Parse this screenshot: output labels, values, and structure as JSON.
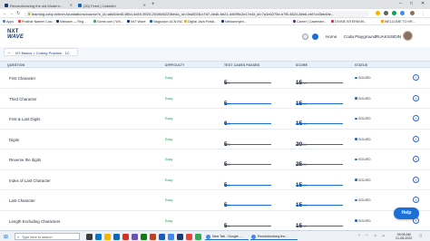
{
  "browser": {
    "tabs": [
      {
        "title": "Revolutionizing the old Modern...",
        "active": false
      },
      {
        "title": "(20) Feed | LinkedIn",
        "active": false
      },
      {
        "title": "learning.ccbp.in",
        "active": true
      }
    ],
    "url": "learning.ccbp.in/tech-foundations/course?c_id=a6d54e46-8f0d-4d49-9920-251f6b52236e&s_id=0ba3028-b7d7-4b4b-bb21-d4f0f9c2e17e&t_id=7a1b0275e-b7f6-4824-8bb6-ebf7cd3bb48e...",
    "bookmarks": [
      "Apps",
      "Prakhar Naeem Coa...",
      "Nxtwave — Reg...",
      "Gcme.com | Wh...",
      "NxT Wave",
      "Nagpurjon UCN INC",
      "Digital Java Portal...",
      "Nxtwave/gen...",
      "Career | Caselearn...",
      "DIVINE INTERNSHI...",
      "WELCOME TO HR..."
    ]
  },
  "app": {
    "logo_top": "NXT",
    "logo_bottom": "WAVE",
    "nav": {
      "home": "Home",
      "coding_playground": "Coda Playground",
      "username": "RUAKSSIDIN"
    }
  },
  "breadcrumb": "I/O Basics > Coding Practice - 1C",
  "table": {
    "headers": [
      "QUESTION",
      "DIFFICULTY",
      "TEST CASES PASSED",
      "SCORE",
      "STATUS"
    ],
    "rows": [
      {
        "question": "First Character",
        "difficulty": "Easy",
        "passed": "5",
        "total": "/5",
        "score": "15",
        "score_total": "/15",
        "progress": 1.0,
        "status": "SOLVED"
      },
      {
        "question": "Third Character",
        "difficulty": "Easy",
        "passed": "5",
        "total": "/5",
        "score": "15",
        "score_total": "/15",
        "progress": 1.0,
        "status": "SOLVED"
      },
      {
        "question": "First & Last Digits",
        "difficulty": "Easy",
        "passed": "6",
        "total": "/6",
        "score": "15",
        "score_total": "/15",
        "progress": 1.0,
        "status": "SOLVED"
      },
      {
        "question": "Digits",
        "difficulty": "Easy",
        "passed": "5",
        "total": "/5",
        "score": "20",
        "score_total": "/20",
        "progress": 1.0,
        "status": "SOLVED"
      },
      {
        "question": "Reverse the digits",
        "difficulty": "Easy",
        "passed": "5",
        "total": "/5",
        "score": "25",
        "score_total": "/25",
        "progress": 1.0,
        "status": "SOLVED"
      },
      {
        "question": "Index of Last Character",
        "difficulty": "Easy",
        "passed": "5",
        "total": "/5",
        "score": "15",
        "score_total": "/15",
        "progress": 1.0,
        "status": "SOLVED"
      },
      {
        "question": "Last Character",
        "difficulty": "Easy",
        "passed": "5",
        "total": "/5",
        "score": "15",
        "score_total": "/15",
        "progress": 1.0,
        "status": "SOLVED"
      },
      {
        "question": "Length Excluding Characters",
        "difficulty": "Easy",
        "passed": "5",
        "total": "/5",
        "score": "15",
        "score_total": "/15",
        "progress": 1.0,
        "status": "SOLVED"
      }
    ]
  },
  "help_label": "Help",
  "taskbar": {
    "search_placeholder": "Type here to search",
    "apps": [
      "New Tab - Google ...",
      "Revolutionizing the..."
    ],
    "time": "09:05 AM",
    "date": "21-08-2022"
  },
  "colors": {
    "accent": "#1d6fd8",
    "easy": "#16a34a",
    "header_bg": "#e9f0f8"
  },
  "icons": {
    "go": "arrow-right-circle-icon",
    "status": "dot-icon"
  }
}
